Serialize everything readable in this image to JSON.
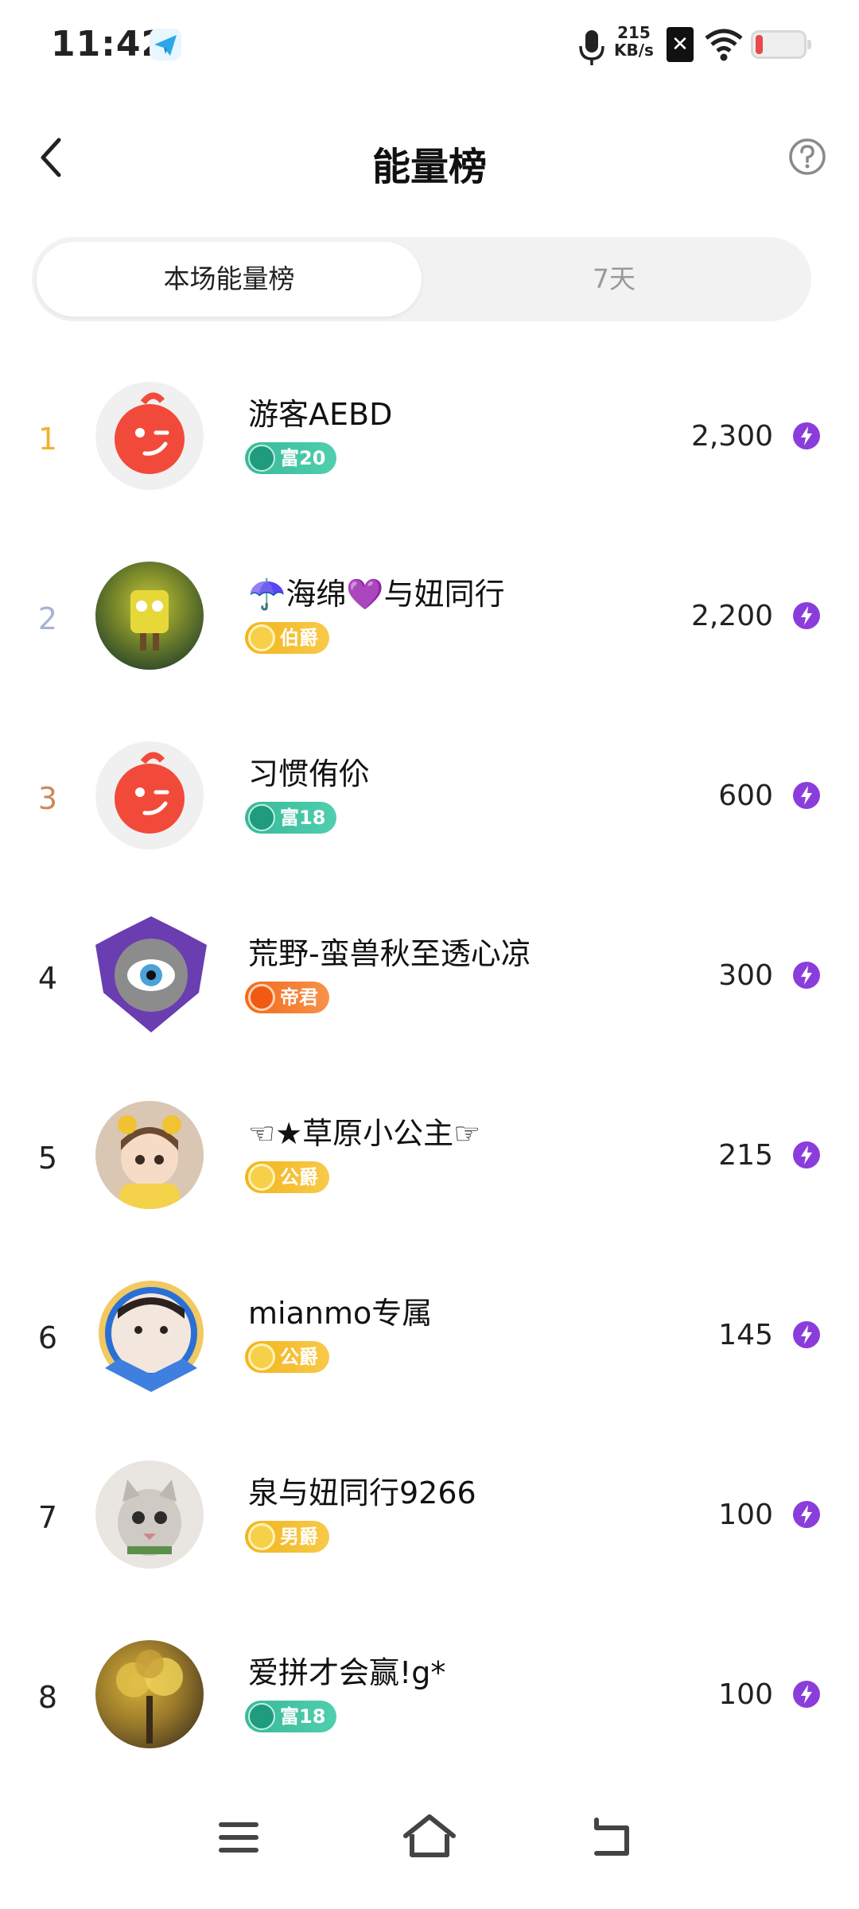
{
  "status": {
    "time": "11:42",
    "speed_value": "215",
    "speed_unit": "KB/s"
  },
  "header": {
    "title": "能量榜"
  },
  "tabs": [
    {
      "label": "本场能量榜"
    },
    {
      "label": "7天"
    }
  ],
  "rows": [
    {
      "rank": "1",
      "name": "游客AEBD",
      "badge": "富20",
      "score": "2,300"
    },
    {
      "rank": "2",
      "name": "☂️海绵💜与妞同行",
      "badge": "伯爵",
      "score": "2,200"
    },
    {
      "rank": "3",
      "name": "习惯侑伱",
      "badge": "富18",
      "score": "600"
    },
    {
      "rank": "4",
      "name": "荒野-蛮兽秋至透心凉",
      "badge": "帝君",
      "score": "300"
    },
    {
      "rank": "5",
      "name": "☜★草原小公主☞",
      "badge": "公爵",
      "score": "215"
    },
    {
      "rank": "6",
      "name": "mianmo专属",
      "badge": "公爵",
      "score": "145"
    },
    {
      "rank": "7",
      "name": "泉与妞同行9266",
      "badge": "男爵",
      "score": "100"
    },
    {
      "rank": "8",
      "name": "爱拼才会赢!g*",
      "badge": "富18",
      "score": "100"
    }
  ],
  "colors": {
    "rank1": "#f2b12b",
    "rank2": "#a8b1d8",
    "rank3": "#c9895b",
    "bolt": "#8b3ddb"
  },
  "icons": [
    "back-arrow-icon",
    "help-icon",
    "energy-bolt-icon",
    "menu-icon",
    "home-icon",
    "back-nav-icon"
  ]
}
